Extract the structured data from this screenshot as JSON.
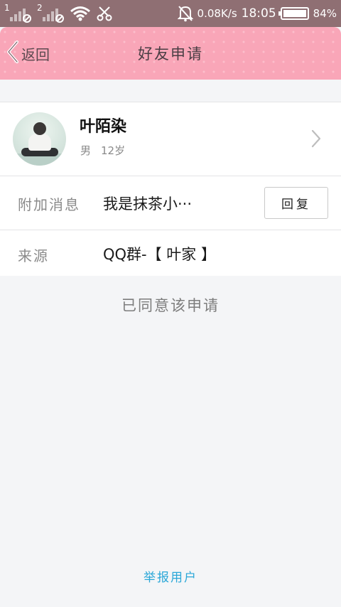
{
  "status_bar": {
    "sim1": "1",
    "sim2": "2",
    "speed": "0.08K/s",
    "time": "18:05",
    "battery": "84%"
  },
  "header": {
    "back_label": "返回",
    "title": "好友申请",
    "color": "#f9a6b8"
  },
  "profile": {
    "name": "叶陌染",
    "gender": "男",
    "age": "12岁"
  },
  "message": {
    "label": "附加消息",
    "value": "我是抹茶小···",
    "reply_button": "回复"
  },
  "source": {
    "label": "来源",
    "value": "QQ群-【 叶家 】"
  },
  "status_text": "已同意该申请",
  "report_link": "举报用户",
  "icons": [
    "signal-icon",
    "wifi-icon",
    "scissor-icon",
    "bell-off-icon",
    "battery-icon",
    "back-arrow-icon",
    "chevron-right-icon"
  ]
}
